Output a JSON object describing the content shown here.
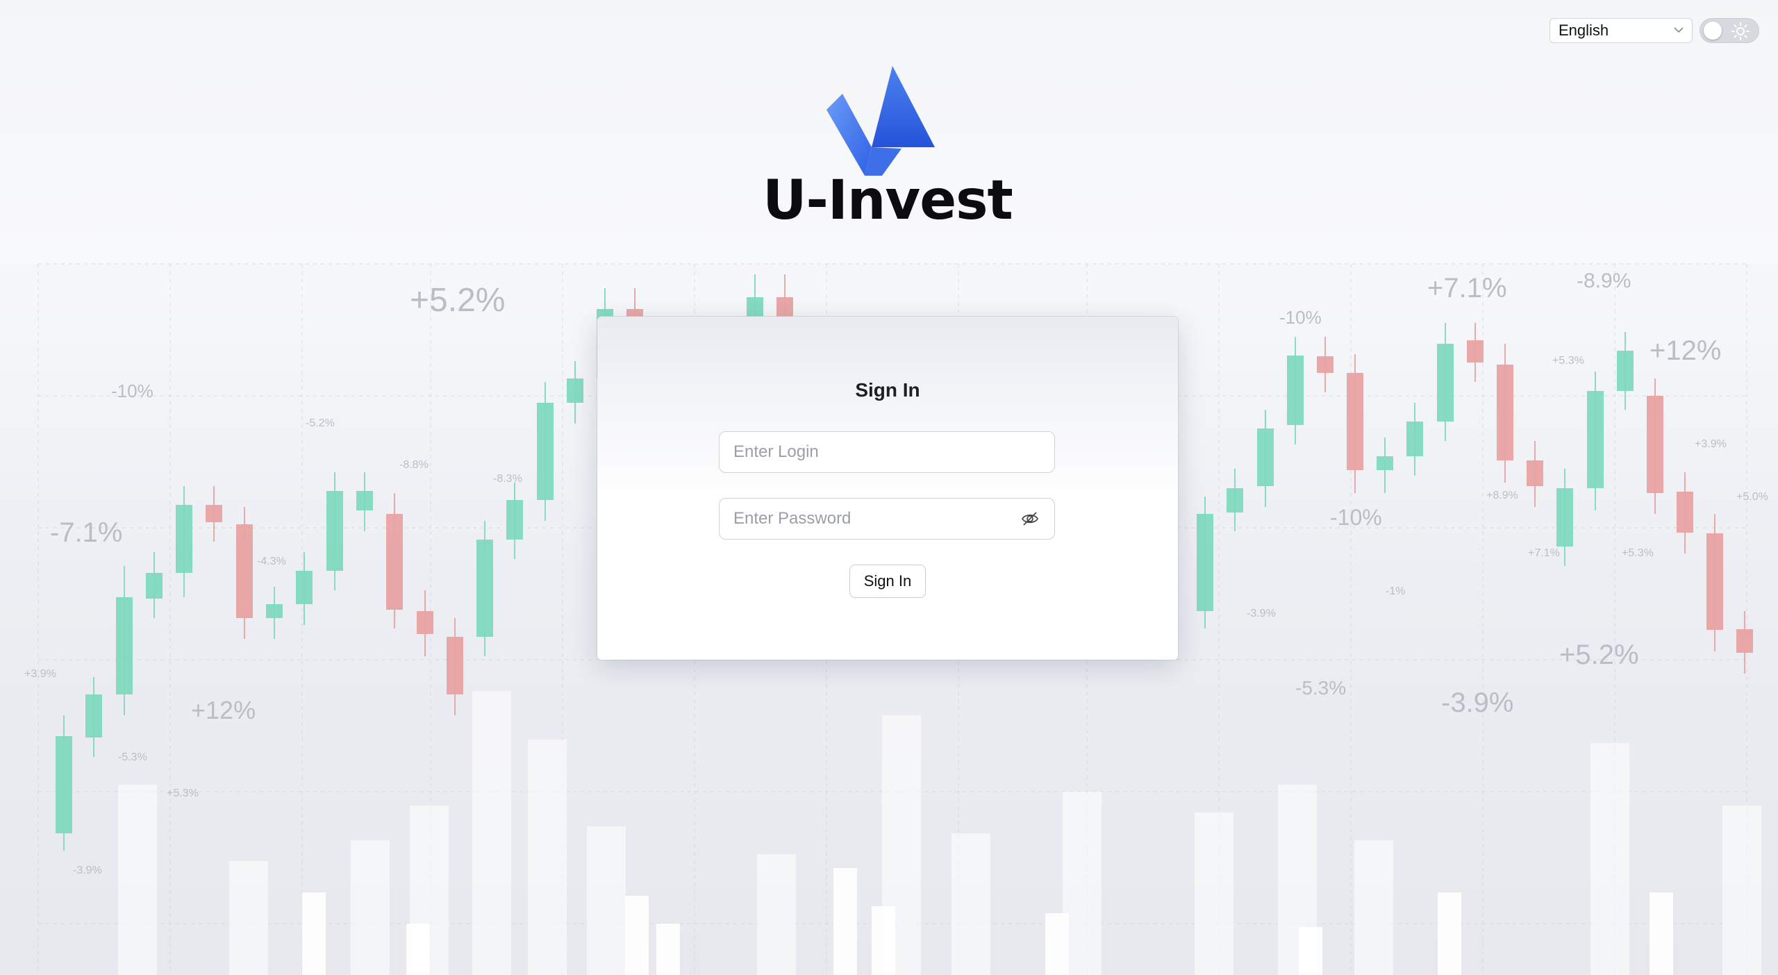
{
  "header": {
    "language_value": "English",
    "brand_name": "U-Invest"
  },
  "login_card": {
    "title": "Sign In",
    "login_placeholder": "Enter Login",
    "password_placeholder": "Enter Password",
    "submit_label": "Sign In"
  },
  "background_labels": [
    "+5.2%",
    "-10%",
    "-7.1%",
    "+12%",
    "-5.2%",
    "-8.8%",
    "-8.3%",
    "-4.3%",
    "+7.1%",
    "-8.9%",
    "-10%",
    "+12%",
    "-10%",
    "-5.3%",
    "-3.9%",
    "+5.2%",
    "+5.3%",
    "+3.9%",
    "+5.0%",
    "+8.9%",
    "+7.1%",
    "+5.3%",
    "-1%",
    "-3.9%",
    "+3.9%",
    "-5.3%",
    "+5.3%",
    "-3.9%"
  ],
  "colors": {
    "up": "#7fd9bd",
    "down": "#e8a2a2",
    "logo_light": "#5b8df2",
    "logo_dark": "#2b5ee3"
  }
}
